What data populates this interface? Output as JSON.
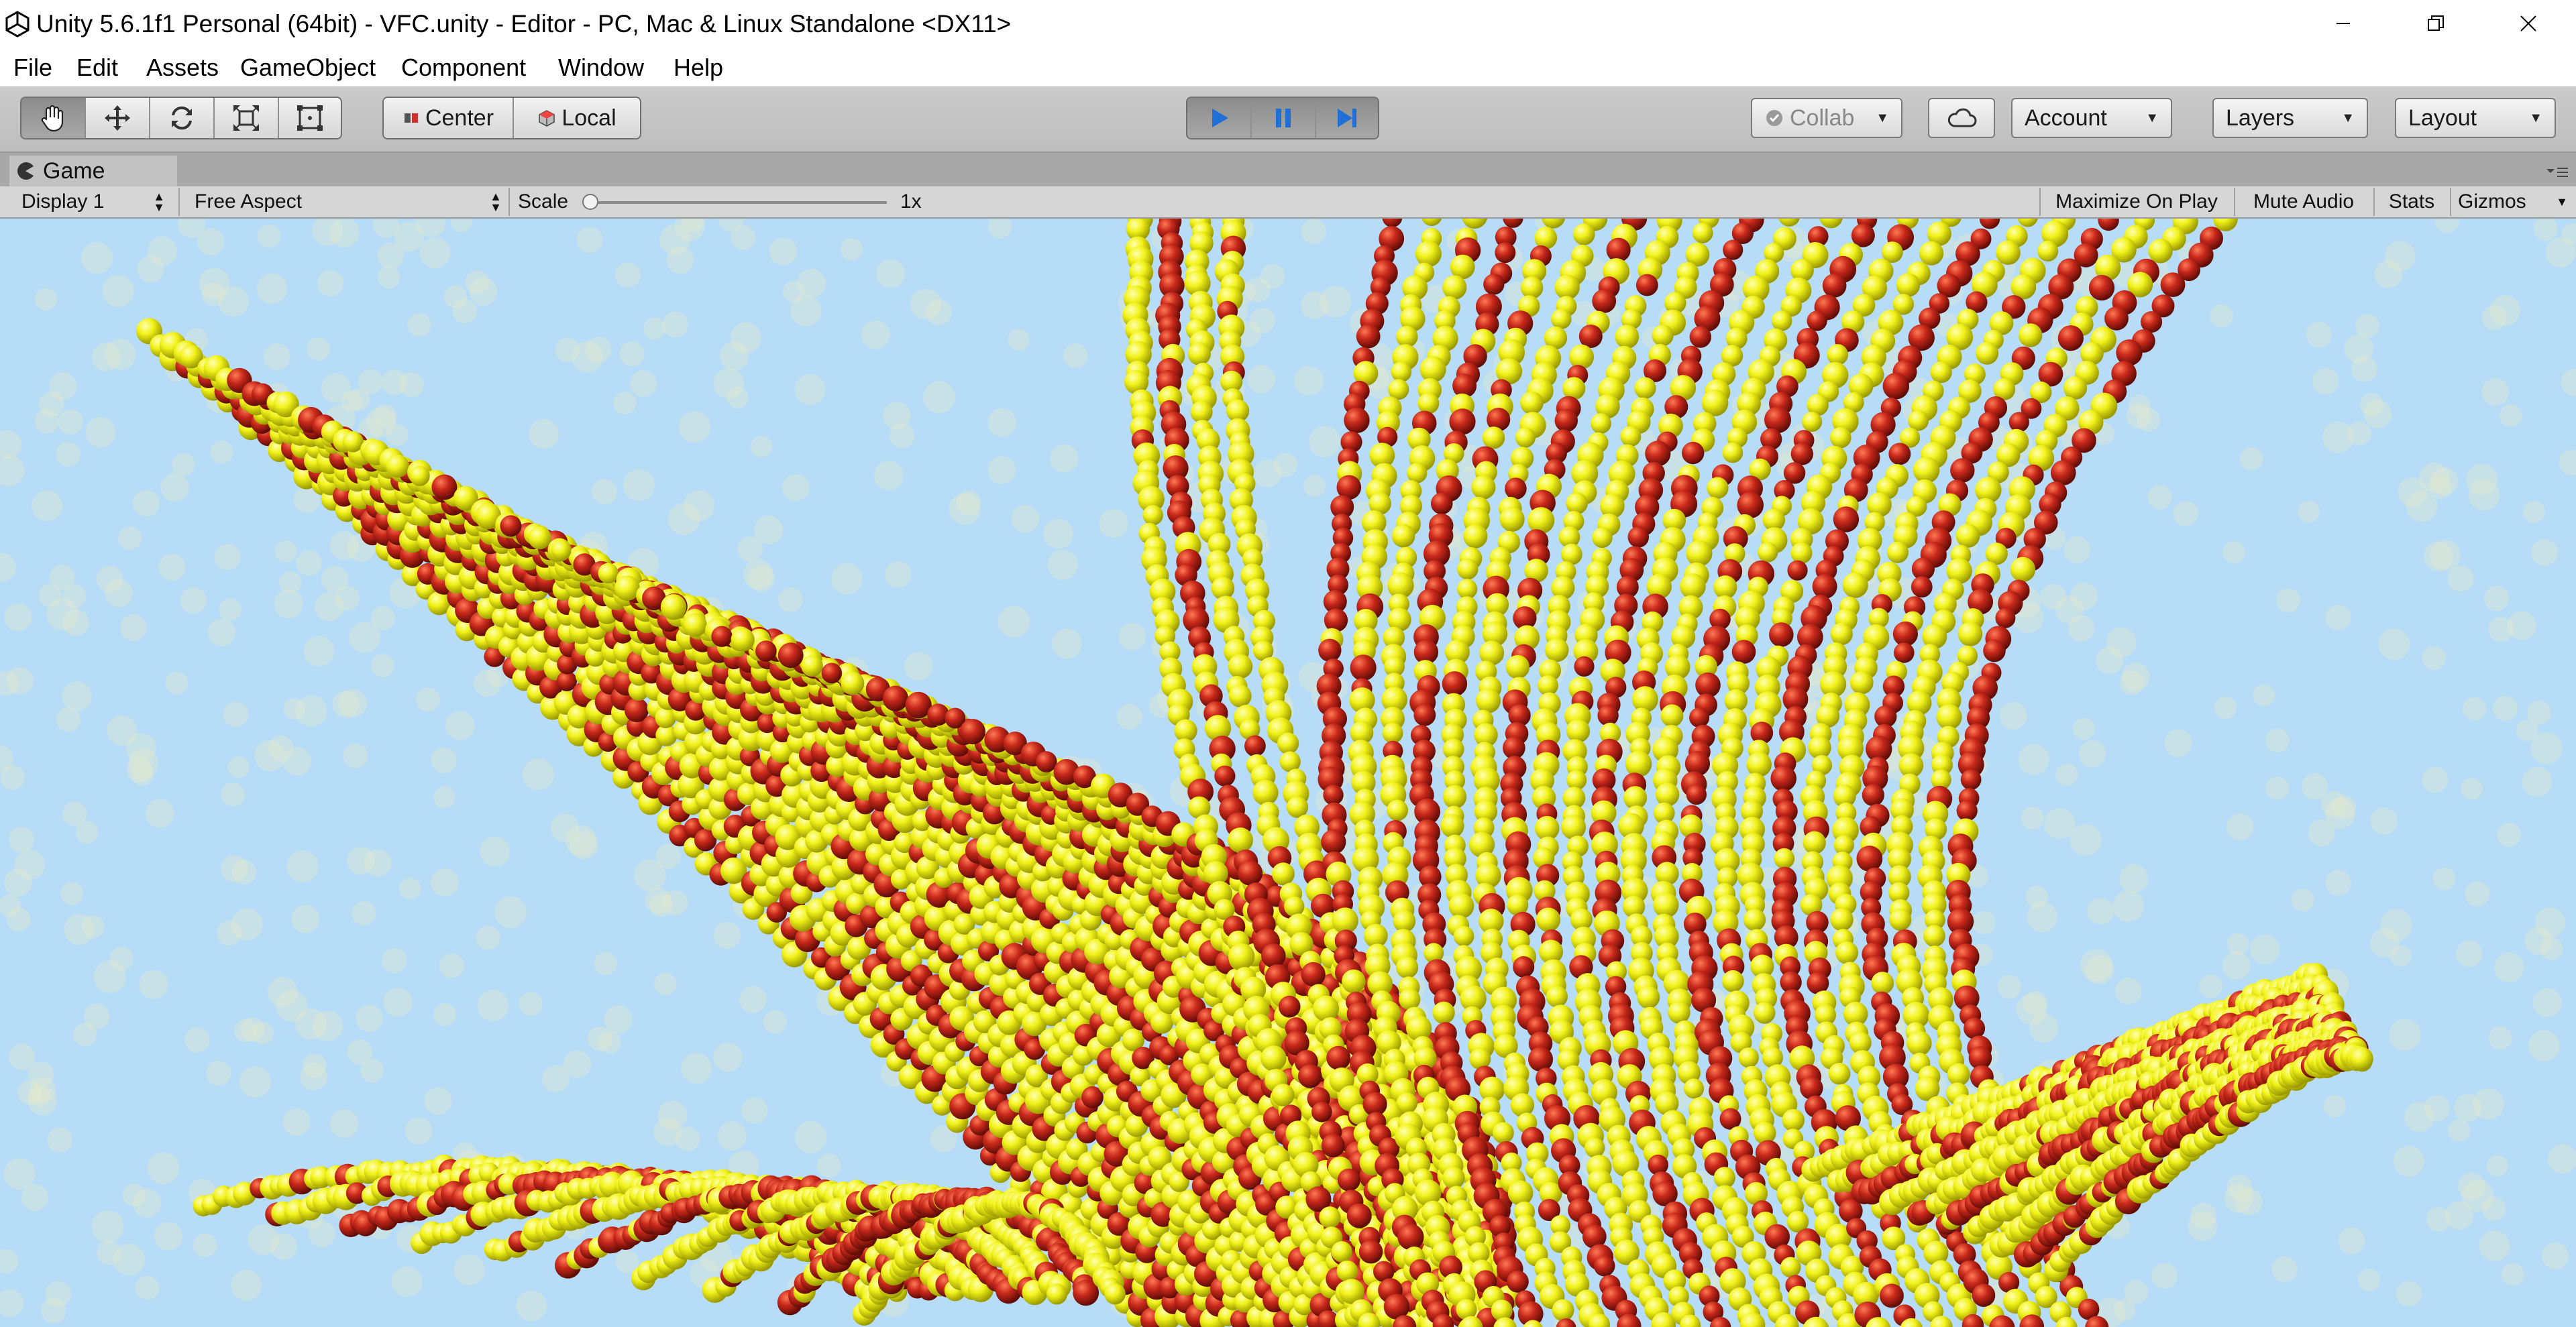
{
  "window": {
    "title": "Unity 5.6.1f1 Personal (64bit) - VFC.unity - Editor - PC, Mac & Linux Standalone <DX11>",
    "icon": "unity-logo-icon",
    "controls": [
      "minimize-icon",
      "restore-icon",
      "close-icon"
    ]
  },
  "menu": [
    "File",
    "Edit",
    "Assets",
    "GameObject",
    "Component",
    "Window",
    "Help"
  ],
  "toolbar": {
    "tools": [
      "hand-icon",
      "move-icon",
      "rotate-icon",
      "scale-icon",
      "rect-tool-icon"
    ],
    "active_tool": "hand-icon",
    "pivot_label": "Center",
    "space_label": "Local",
    "playback": [
      "play-icon",
      "pause-icon",
      "step-icon"
    ],
    "collab_label": "Collab",
    "cloud_icon": "cloud-icon",
    "account_label": "Account",
    "layers_label": "Layers",
    "layout_label": "Layout"
  },
  "game_view": {
    "tab_label": "Game",
    "display_label": "Display 1",
    "aspect_label": "Free Aspect",
    "scale_label": "Scale",
    "scale_value": "1x",
    "maximize_label": "Maximize On Play",
    "mute_label": "Mute Audio",
    "stats_label": "Stats",
    "gizmos_label": "Gizmos"
  },
  "colors": {
    "background": "#b6dcf7",
    "sphere_yellow": "#f2f21a",
    "sphere_red": "#c8281a",
    "play_blue": "#1f6fd6"
  }
}
